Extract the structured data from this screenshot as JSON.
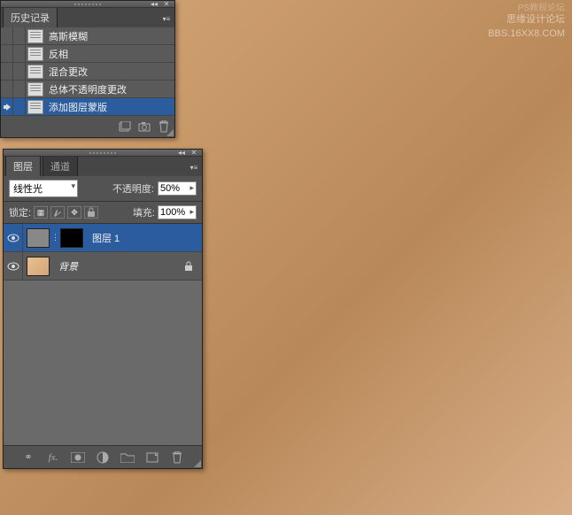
{
  "watermark": {
    "line1": "思缘设计论坛",
    "line2": "BBS.16XX8.COM",
    "corner": "PS教程论坛"
  },
  "history": {
    "tab": "历史记录",
    "items": [
      {
        "label": "高斯模糊"
      },
      {
        "label": "反相"
      },
      {
        "label": "混合更改"
      },
      {
        "label": "总体不透明度更改"
      },
      {
        "label": "添加图层蒙版",
        "selected": true
      }
    ]
  },
  "layers": {
    "tabs": {
      "layers": "图层",
      "channels": "通道"
    },
    "blend_label": "线性光",
    "opacity_label": "不透明度:",
    "opacity_value": "50%",
    "lock_label": "锁定:",
    "fill_label": "填充:",
    "fill_value": "100%",
    "items": [
      {
        "name": "图层 1",
        "selected": true,
        "masked": true
      },
      {
        "name": "背景",
        "locked": true
      }
    ]
  }
}
